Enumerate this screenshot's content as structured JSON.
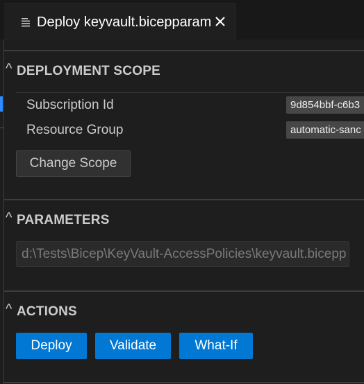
{
  "tab": {
    "title": "Deploy keyvault.bicepparam",
    "icon": "file-lines-icon",
    "close_icon": "close-icon"
  },
  "sections": {
    "scope": {
      "title": "DEPLOYMENT SCOPE",
      "subscription_label": "Subscription Id",
      "subscription_value": "9d854bbf-c6b3",
      "resource_group_label": "Resource Group",
      "resource_group_value": "automatic-sanc",
      "change_scope_label": "Change Scope"
    },
    "parameters": {
      "title": "PARAMETERS",
      "file_path": "d:\\Tests\\Bicep\\KeyVault-AccessPolicies\\keyvault.bicepp"
    },
    "actions": {
      "title": "ACTIONS",
      "deploy_label": "Deploy",
      "validate_label": "Validate",
      "whatif_label": "What-If"
    }
  },
  "colors": {
    "background": "#1e1e1e",
    "primary_button": "#0078d4",
    "secondary_button": "#313131"
  }
}
